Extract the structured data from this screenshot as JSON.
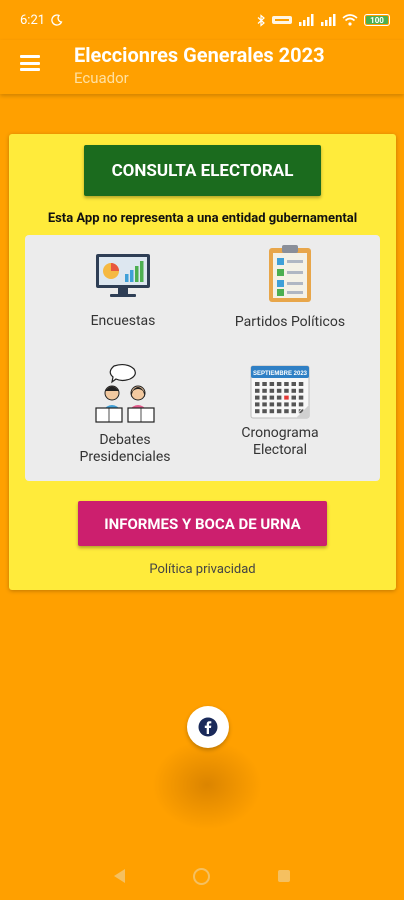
{
  "status_bar": {
    "time": "6:21",
    "battery": "100"
  },
  "app_bar": {
    "title": "Eleccionres Generales 2023",
    "subtitle": "Ecuador"
  },
  "main": {
    "consulta_label": "CONSULTA ELECTORAL",
    "disclaimer": "Esta App no representa a una entidad gubernamental",
    "grid": {
      "encuestas": "Encuestas",
      "partidos": "Partidos Políticos",
      "debates_line1": "Debates",
      "debates_line2": "Presidenciales",
      "cronograma_line1": "Cronograma",
      "cronograma_line2": "Electoral"
    },
    "calendar_header": "SEPTIEMBRE 2023",
    "informes_label": "INFORMES Y BOCA DE URNA",
    "privacy_label": "Política privacidad"
  },
  "colors": {
    "background": "#FFA000",
    "card": "#FFEB3B",
    "consulta_button": "#1B6B1E",
    "informes_button": "#CC1F6E",
    "facebook": "#1A2A5A"
  },
  "icons": {
    "facebook": "facebook-icon",
    "menu": "menu-icon"
  }
}
